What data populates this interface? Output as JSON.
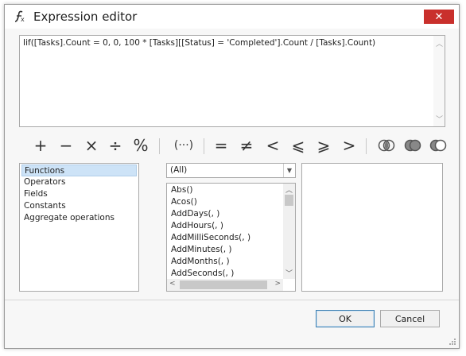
{
  "window": {
    "title": "Expression editor",
    "close_label": "✕"
  },
  "expression": {
    "text": "Iif([Tasks].Count = 0, 0, 100 * [Tasks][[Status] = 'Completed'].Count / [Tasks].Count)"
  },
  "toolbar": {
    "operators": [
      {
        "symbol": "+",
        "icon": "plus-icon"
      },
      {
        "symbol": "−",
        "icon": "minus-icon"
      },
      {
        "symbol": "×",
        "icon": "multiply-icon"
      },
      {
        "symbol": "÷",
        "icon": "divide-icon"
      },
      {
        "symbol": "%",
        "icon": "percent-icon"
      },
      {
        "symbol": "(···)",
        "icon": "parentheses-icon"
      },
      {
        "symbol": "=",
        "icon": "equal-icon"
      },
      {
        "symbol": "≠",
        "icon": "not-equal-icon"
      },
      {
        "symbol": "<",
        "icon": "less-than-icon"
      },
      {
        "symbol": "⩽",
        "icon": "less-or-equal-icon"
      },
      {
        "symbol": "⩾",
        "icon": "greater-or-equal-icon"
      },
      {
        "symbol": ">",
        "icon": "greater-than-icon"
      }
    ],
    "logic_icons": [
      "and-icon",
      "or-icon",
      "not-icon"
    ]
  },
  "categories": {
    "items": [
      "Functions",
      "Operators",
      "Fields",
      "Constants",
      "Aggregate operations"
    ],
    "selected": "Functions"
  },
  "filter": {
    "selected": "(All)"
  },
  "functions": {
    "items": [
      "Abs()",
      "Acos()",
      "AddDays(, )",
      "AddHours(, )",
      "AddMilliSeconds(, )",
      "AddMinutes(, )",
      "AddMonths(, )",
      "AddSeconds(, )"
    ]
  },
  "description": {
    "text": ""
  },
  "buttons": {
    "ok": "OK",
    "cancel": "Cancel"
  },
  "colors": {
    "close": "#c9302c",
    "selection": "#cde3f7",
    "primary_border": "#3c7fb1"
  }
}
